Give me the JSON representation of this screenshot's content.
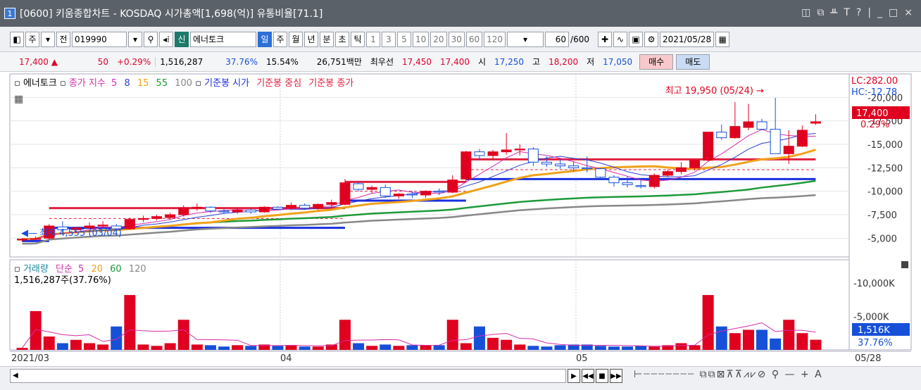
{
  "window": {
    "badge": "1",
    "title": "[0600] 키움종합차트 - KOSDAQ 시가총액[1,698(억)] 유통비율[71.1]",
    "controls": [
      "◫",
      "⧉",
      "ᚇ",
      "T",
      "?",
      "|",
      "_",
      "□",
      "×"
    ]
  },
  "toolbar": {
    "market": "주",
    "prefix": "전",
    "code": "019990",
    "new_badge": "신",
    "stock_name": "에너토크",
    "periods": [
      "일",
      "주",
      "월",
      "년",
      "분",
      "초",
      "틱"
    ],
    "minutes": [
      "1",
      "3",
      "5",
      "10",
      "20",
      "30",
      "60",
      "120"
    ],
    "count": "60",
    "count_total": "/600",
    "date": "2021/05/28"
  },
  "info": {
    "price": "17,400",
    "arrow": "▲",
    "change": "50",
    "change_pct": "+0.29%",
    "volume": "1,516,287",
    "vol_ratio": "37.76%",
    "turnover": "15.54%",
    "amount": "26,751백만",
    "best_label": "최우선",
    "ask": "17,450",
    "bid": "17,400",
    "open_label": "시",
    "open": "17,250",
    "high_label": "고",
    "high": "18,200",
    "low_label": "저",
    "low": "17,050",
    "buy": "매수",
    "sell": "매도"
  },
  "legend": {
    "name": "에너토크",
    "ma_label": "종가 지수",
    "ma": [
      "5",
      "8",
      "15",
      "55",
      "100"
    ],
    "base1": "기준봉 시가",
    "base2": "기준봉 중심",
    "base3": "기준봉 종가"
  },
  "vol_legend": {
    "label": "거래량",
    "kind": "단순",
    "ma": [
      "5",
      "20",
      "60",
      "120"
    ],
    "value": "1,516,287주(37.76%)"
  },
  "annotations": {
    "high": "최고 19,950 (05/24)",
    "low": "최저 4,555 (03/04)",
    "lc": "LC:282.00",
    "hc": "HC:-12.78",
    "last_price": "17,400",
    "last_pct": "0.29%",
    "last_vol": "1,516K",
    "last_vol_pct": "37.76%"
  },
  "colors": {
    "up": "#e0001f",
    "down": "#1650d8",
    "ma5": "#d62ca8",
    "ma8": "#2f3fd0",
    "ma15": "#f0a21a",
    "ma55": "#1e9a3a",
    "ma100": "#888888",
    "base_open": "#1a2fe0",
    "base_mid": "#e02040",
    "base_close": "#e02040"
  },
  "chart_data": {
    "type": "candlestick",
    "x_labels": [
      "2021/03",
      "04",
      "05",
      "05/28"
    ],
    "price_ticks": [
      "20,000",
      "17,500",
      "15,000",
      "12,500",
      "10,000",
      "7,500",
      "5,000"
    ],
    "volume_ticks": [
      "10,000K",
      "5,000K"
    ],
    "ylim": [
      3000,
      22500
    ],
    "vol_max": 12000,
    "candles": [
      [
        4800,
        5000,
        4600,
        4900
      ],
      [
        4900,
        5200,
        4800,
        4950
      ],
      [
        5000,
        6500,
        4900,
        6300
      ],
      [
        6200,
        6800,
        5600,
        5900
      ],
      [
        5900,
        6200,
        5500,
        6100
      ],
      [
        6100,
        6700,
        6000,
        6300
      ],
      [
        6300,
        6800,
        6100,
        6400
      ],
      [
        6300,
        6500,
        5900,
        6000
      ],
      [
        6000,
        7200,
        5900,
        7000
      ],
      [
        7000,
        7400,
        6700,
        7100
      ],
      [
        7100,
        7500,
        6900,
        7300
      ],
      [
        7200,
        7700,
        7000,
        7500
      ],
      [
        7500,
        8500,
        7300,
        8200
      ],
      [
        8200,
        8700,
        7900,
        8300
      ],
      [
        8300,
        8400,
        7700,
        7900
      ],
      [
        7900,
        8100,
        7600,
        7800
      ],
      [
        7800,
        8200,
        7600,
        8000
      ],
      [
        8000,
        8100,
        7600,
        7800
      ],
      [
        7800,
        8400,
        7700,
        8300
      ],
      [
        8300,
        8400,
        8000,
        8100
      ],
      [
        8200,
        8800,
        8000,
        8500
      ],
      [
        8500,
        8700,
        8000,
        8200
      ],
      [
        8200,
        8700,
        8000,
        8600
      ],
      [
        8600,
        9100,
        8200,
        8800
      ],
      [
        8600,
        11300,
        8500,
        10900
      ],
      [
        10800,
        11000,
        10000,
        10200
      ],
      [
        10200,
        10600,
        9800,
        10400
      ],
      [
        10400,
        10700,
        9300,
        9500
      ],
      [
        9500,
        9800,
        9200,
        9700
      ],
      [
        9700,
        10000,
        9300,
        9600
      ],
      [
        9600,
        10100,
        9300,
        10000
      ],
      [
        10000,
        10300,
        9600,
        9900
      ],
      [
        9900,
        11700,
        9800,
        11200
      ],
      [
        11300,
        14300,
        11000,
        14200
      ],
      [
        14200,
        14500,
        13300,
        13800
      ],
      [
        13800,
        14400,
        13500,
        14200
      ],
      [
        14200,
        16200,
        13900,
        14400
      ],
      [
        14400,
        15000,
        13800,
        14500
      ],
      [
        14500,
        14700,
        12700,
        13100
      ],
      [
        13100,
        13700,
        12600,
        12900
      ],
      [
        12900,
        13400,
        12400,
        12700
      ],
      [
        12700,
        13200,
        12100,
        12500
      ],
      [
        12500,
        13700,
        12000,
        12400
      ],
      [
        12400,
        12500,
        11300,
        11500
      ],
      [
        11500,
        11700,
        10500,
        10900
      ],
      [
        10900,
        11600,
        10400,
        10700
      ],
      [
        10600,
        11200,
        10300,
        10500
      ],
      [
        10500,
        11900,
        10300,
        11700
      ],
      [
        11700,
        12300,
        11500,
        12100
      ],
      [
        12100,
        13100,
        11800,
        12500
      ],
      [
        12500,
        13400,
        12200,
        13300
      ],
      [
        13300,
        16300,
        13200,
        16300
      ],
      [
        16300,
        17100,
        15500,
        15700
      ],
      [
        15700,
        19500,
        15600,
        16900
      ],
      [
        16800,
        19300,
        16500,
        17400
      ],
      [
        17400,
        17700,
        16500,
        16600
      ],
      [
        16600,
        19950,
        16500,
        14000
      ],
      [
        14000,
        16500,
        12900,
        14800
      ],
      [
        14800,
        17000,
        14700,
        16500
      ],
      [
        17250,
        18200,
        17050,
        17400
      ]
    ],
    "volumes": [
      300,
      5800,
      2000,
      1000,
      1500,
      1000,
      800,
      3500,
      8200,
      800,
      600,
      1000,
      4500,
      800,
      700,
      500,
      700,
      600,
      800,
      600,
      700,
      500,
      500,
      800,
      4500,
      1000,
      600,
      800,
      600,
      700,
      700,
      700,
      4500,
      1000,
      3500,
      1800,
      1500,
      800,
      600,
      500,
      700,
      800,
      800,
      600,
      500,
      500,
      600,
      500,
      700,
      1000,
      700,
      8200,
      3500,
      2500,
      3000,
      3000,
      1700,
      4500,
      2500,
      1516
    ]
  }
}
